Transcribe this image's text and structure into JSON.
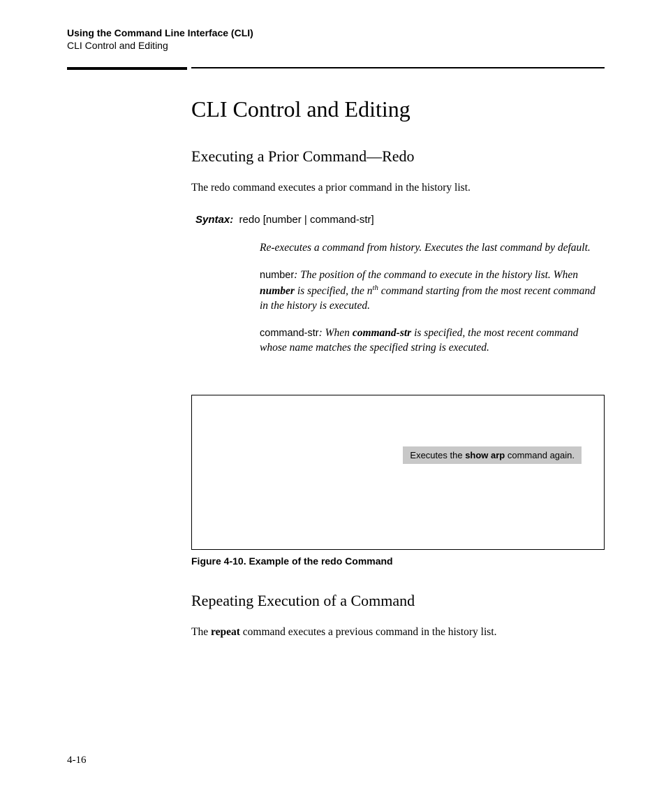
{
  "header": {
    "title": "Using the Command Line Interface (CLI)",
    "subtitle": "CLI Control and Editing"
  },
  "main": {
    "h1": "CLI Control and Editing",
    "section1": {
      "h2": "Executing a Prior Command—Redo",
      "intro": "The redo command executes a prior command in the history list.",
      "syntax_label": "Syntax:",
      "syntax_cmd": "redo [number | command-str]",
      "syntax_desc": "Re-executes a command from history. Executes the last command by default.",
      "param1_name": "number",
      "param1_text1": ": The position of the command to execute in the history list. When ",
      "param1_bold": "number",
      "param1_text2": " is specified, the n",
      "param1_sup": "th",
      "param1_text3": " command starting from the most recent command in the history is executed.",
      "param2_name": "command-str",
      "param2_text1": ": When ",
      "param2_bold": "command-str",
      "param2_text2": " is specified, the most recent command whose name matches the specified string is executed.",
      "callout_pre": "Executes the ",
      "callout_bold": "show arp",
      "callout_post": " command again.",
      "figure_caption": "Figure 4-10.  Example of the redo Command"
    },
    "section2": {
      "h2": "Repeating Execution of a Command",
      "intro_pre": "The ",
      "intro_bold": "repeat",
      "intro_post": " command executes a previous command in the history list."
    }
  },
  "page_number": "4-16"
}
